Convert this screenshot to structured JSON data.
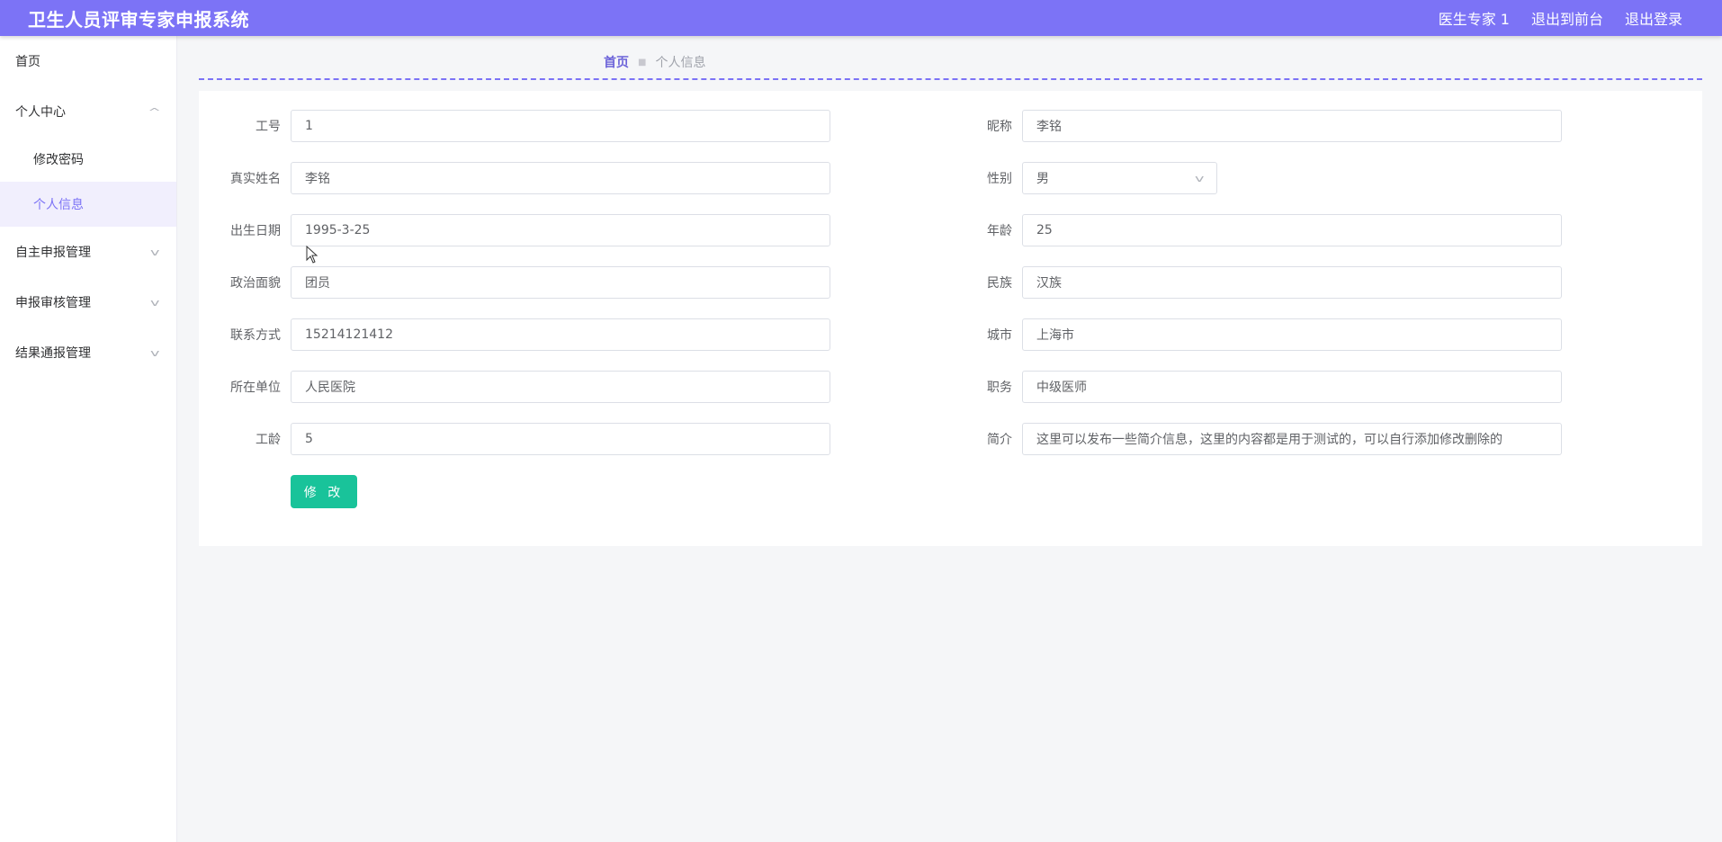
{
  "header": {
    "title": "卫生人员评审专家申报系统",
    "user": "医生专家 1",
    "back_to_front": "退出到前台",
    "logout": "退出登录"
  },
  "sidebar": {
    "home": "首页",
    "personal_center": "个人中心",
    "change_password": "修改密码",
    "personal_info": "个人信息",
    "self_declare": "自主申报管理",
    "declare_review": "申报审核管理",
    "result_notify": "结果通报管理"
  },
  "breadcrumb": {
    "home": "首页",
    "current": "个人信息"
  },
  "form": {
    "labels": {
      "job_no": "工号",
      "nickname": "昵称",
      "real_name": "真实姓名",
      "gender": "性别",
      "birth_date": "出生日期",
      "age": "年龄",
      "political_status": "政治面貌",
      "ethnicity": "民族",
      "contact": "联系方式",
      "city": "城市",
      "organization": "所在单位",
      "position": "职务",
      "work_years": "工龄",
      "intro": "简介"
    },
    "values": {
      "job_no": "1",
      "nickname": "李铭",
      "real_name": "李铭",
      "gender": "男",
      "birth_date": "1995-3-25",
      "age": "25",
      "political_status": "团员",
      "ethnicity": "汉族",
      "contact": "15214121412",
      "city": "上海市",
      "organization": "人民医院",
      "position": "中级医师",
      "work_years": "5",
      "intro": "这里可以发布一些简介信息，这里的内容都是用于测试的，可以自行添加修改删除的"
    },
    "submit_label": "修 改"
  },
  "colors": {
    "primary": "#7c73f6",
    "button": "#19c39a"
  }
}
